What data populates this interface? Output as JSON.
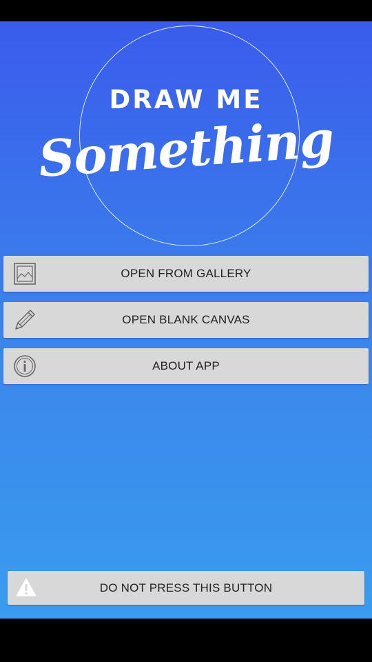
{
  "logo": {
    "line1": "DRAW ME",
    "line2": "Something"
  },
  "menu": {
    "gallery": {
      "label": "OPEN FROM GALLERY",
      "icon": "image-icon"
    },
    "blank": {
      "label": "OPEN BLANK CANVAS",
      "icon": "pencil-icon"
    },
    "about": {
      "label": "ABOUT APP",
      "icon": "info-icon"
    }
  },
  "danger": {
    "label": "DO NOT PRESS THIS BUTTON",
    "icon": "warning-icon"
  },
  "colors": {
    "gradient_top": "#3a5cec",
    "gradient_bottom": "#3a9cee",
    "button_bg": "#d8d8d8"
  }
}
